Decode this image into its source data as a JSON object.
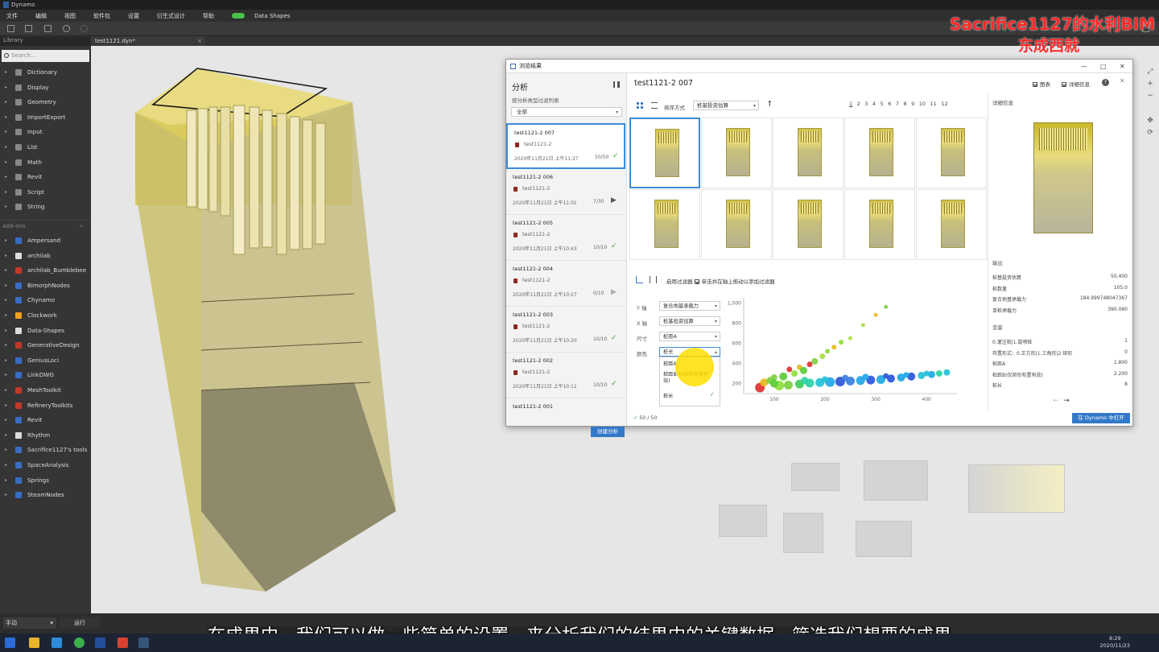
{
  "app": {
    "title": "Dynamo"
  },
  "menu": [
    "文件",
    "编辑",
    "视图",
    "软件包",
    "设置",
    "衍生式设计",
    "帮助",
    "Data Shapes"
  ],
  "library": {
    "title": "Library",
    "search_placeholder": "Search...",
    "core_items": [
      "Dictionary",
      "Display",
      "Geometry",
      "ImportExport",
      "Input",
      "List",
      "Math",
      "Revit",
      "Script",
      "String"
    ],
    "addons_title": "Add-ons",
    "addon_items": [
      "Ampersand",
      "archilab",
      "archilab_Bumblebee",
      "BimorphNodes",
      "Chynamo",
      "Clockwork",
      "Data-Shapes",
      "GenerativeDesign",
      "GeniusLoci",
      "LinkDWG",
      "MeshToolkit",
      "RefineryToolkits",
      "Revit",
      "Rhythm",
      "Sacrifice1127's tools",
      "SpaceAnalysis",
      "Springs",
      "SteamNodes"
    ]
  },
  "file_tab": {
    "label": "test1121.dyn*",
    "close": "×"
  },
  "watermark": {
    "line1": "Sacrifice1127的水利BIM",
    "line2": "东成西就"
  },
  "subtitle": "在成果中，我们可以做一些简单的设置，来分析我们的结果中的关键数据，筛选我们想要的成果",
  "bottom": {
    "run_mode": "手动",
    "run_button": "运行"
  },
  "taskbar": {
    "time": "8:29",
    "date": "2020/11/23"
  },
  "dialog": {
    "title": "浏览结果",
    "left": {
      "heading": "分析",
      "filter_label": "按分析类型过滤列表",
      "filter_value": "全部",
      "runs": [
        {
          "name": "test1121-2 007",
          "study": "test1121-2",
          "date": "2020年11月21日 上午11:27",
          "count": "50/50",
          "status": "✓"
        },
        {
          "name": "test1121-2 006",
          "study": "test1121-2",
          "date": "2020年11月21日 上午11:01",
          "count": "7/30",
          "status": "▶"
        },
        {
          "name": "test1121-2 005",
          "study": "test1121-2",
          "date": "2020年11月21日 上午10:43",
          "count": "10/10",
          "status": "✓"
        },
        {
          "name": "test1121-2 004",
          "study": "test1121-2",
          "date": "2020年11月21日 上午10:27",
          "count": "0/10",
          "status": "▶"
        },
        {
          "name": "test1121-2 003",
          "study": "test1121-2",
          "date": "2020年11月21日 上午10:20",
          "count": "10/10",
          "status": "✓"
        },
        {
          "name": "test1121-2 002",
          "study": "test1121-2",
          "date": "2020年11月21日 上午10:11",
          "count": "10/10",
          "status": "✓"
        },
        {
          "name": "test1121-2 001",
          "study": "",
          "date": "",
          "count": "",
          "status": ""
        }
      ],
      "create_button": "创建分析"
    },
    "main": {
      "heading": "test1121-2 007",
      "chart_toggle": "图表",
      "detail_toggle": "详细信息",
      "sort_label": "排序方式",
      "sort_value": "桩基投资估算",
      "pages": [
        "1",
        "2",
        "3",
        "4",
        "5",
        "6",
        "7",
        "8",
        "9",
        "10",
        "11",
        "12"
      ],
      "filter_enable": "启用过滤器",
      "filter_hint": "单击并在轴上拖动以添加过滤器",
      "y_label": "Y 轴",
      "y_value": "复合地基承载力",
      "x_label": "X 轴",
      "x_value": "桩基投资估算",
      "size_label": "尺寸",
      "size_value": "桩距A",
      "color_label": "颜色",
      "color_value": "桩长",
      "dropdown_options": [
        "桩距A",
        "桩距B(仅矩形布置有效)",
        "桩长"
      ],
      "result_count": "50 / 50",
      "open_button": "在 Dynamo 中打开"
    },
    "detail": {
      "title": "详细信息",
      "outputs_title": "输出",
      "outputs": [
        {
          "k": "桩基投资估算",
          "v": "50.400"
        },
        {
          "k": "桩数量",
          "v": "105.0"
        },
        {
          "k": "复合地基承载力",
          "v": "184.999748047367"
        },
        {
          "k": "单桩承载力",
          "v": "390.060"
        }
      ],
      "vars_title": "变量",
      "vars": [
        {
          "k": "0.灌注桩|1.旋喷桩",
          "v": "1"
        },
        {
          "k": "布置形式：0.正方形|1.三角形|2.矩形",
          "v": "0"
        },
        {
          "k": "桩距A",
          "v": "1.800"
        },
        {
          "k": "桩距B(仅矩形布置有效)",
          "v": "2.200"
        },
        {
          "k": "桩长",
          "v": "8"
        }
      ]
    }
  },
  "chart_data": {
    "type": "scatter",
    "x_ticks": [
      "100",
      "200",
      "300",
      "400"
    ],
    "y_ticks": [
      "1,000",
      "800",
      "600",
      "400",
      "200"
    ],
    "xlim": [
      40,
      460
    ],
    "ylim": [
      100,
      1050
    ],
    "points": [
      {
        "x": 72,
        "y": 160,
        "s": 10,
        "c": "#e03030"
      },
      {
        "x": 80,
        "y": 210,
        "s": 8,
        "c": "#e8b820"
      },
      {
        "x": 92,
        "y": 230,
        "s": 7,
        "c": "#7ed040"
      },
      {
        "x": 100,
        "y": 260,
        "s": 6,
        "c": "#7ed040"
      },
      {
        "x": 118,
        "y": 270,
        "s": 8,
        "c": "#5ccc3a"
      },
      {
        "x": 130,
        "y": 340,
        "s": 5,
        "c": "#e03030"
      },
      {
        "x": 140,
        "y": 300,
        "s": 6,
        "c": "#8edc3e"
      },
      {
        "x": 150,
        "y": 360,
        "s": 5,
        "c": "#e8b820"
      },
      {
        "x": 158,
        "y": 330,
        "s": 7,
        "c": "#5ccc3a"
      },
      {
        "x": 170,
        "y": 390,
        "s": 5,
        "c": "#e03030"
      },
      {
        "x": 180,
        "y": 420,
        "s": 6,
        "c": "#7ed040"
      },
      {
        "x": 195,
        "y": 470,
        "s": 5,
        "c": "#a8e040"
      },
      {
        "x": 205,
        "y": 520,
        "s": 4,
        "c": "#8edc3e"
      },
      {
        "x": 218,
        "y": 560,
        "s": 4,
        "c": "#e8b820"
      },
      {
        "x": 232,
        "y": 610,
        "s": 4,
        "c": "#8edc3e"
      },
      {
        "x": 250,
        "y": 650,
        "s": 3,
        "c": "#a8e040"
      },
      {
        "x": 275,
        "y": 780,
        "s": 3,
        "c": "#a8e040"
      },
      {
        "x": 300,
        "y": 880,
        "s": 3,
        "c": "#e8b820"
      },
      {
        "x": 320,
        "y": 960,
        "s": 3,
        "c": "#7ed040"
      },
      {
        "x": 110,
        "y": 180,
        "s": 10,
        "c": "#8edc3e"
      },
      {
        "x": 128,
        "y": 185,
        "s": 9,
        "c": "#7ed040"
      },
      {
        "x": 150,
        "y": 195,
        "s": 9,
        "c": "#3fcc5a"
      },
      {
        "x": 170,
        "y": 205,
        "s": 9,
        "c": "#2ad3a6"
      },
      {
        "x": 190,
        "y": 210,
        "s": 9,
        "c": "#22c0d8"
      },
      {
        "x": 210,
        "y": 215,
        "s": 10,
        "c": "#1ea7e6"
      },
      {
        "x": 230,
        "y": 220,
        "s": 10,
        "c": "#2b56d8"
      },
      {
        "x": 250,
        "y": 225,
        "s": 9,
        "c": "#3a80e0"
      },
      {
        "x": 270,
        "y": 230,
        "s": 9,
        "c": "#1ea7e6"
      },
      {
        "x": 290,
        "y": 235,
        "s": 9,
        "c": "#2b56d8"
      },
      {
        "x": 310,
        "y": 240,
        "s": 9,
        "c": "#1ea7e6"
      },
      {
        "x": 330,
        "y": 250,
        "s": 8,
        "c": "#2b56d8"
      },
      {
        "x": 350,
        "y": 260,
        "s": 8,
        "c": "#1ea7e6"
      },
      {
        "x": 370,
        "y": 270,
        "s": 8,
        "c": "#2b56d8"
      },
      {
        "x": 390,
        "y": 280,
        "s": 7,
        "c": "#22c0d8"
      },
      {
        "x": 410,
        "y": 290,
        "s": 7,
        "c": "#1ea7e6"
      },
      {
        "x": 425,
        "y": 300,
        "s": 6,
        "c": "#2ad3a6"
      },
      {
        "x": 440,
        "y": 310,
        "s": 6,
        "c": "#22c0d8"
      },
      {
        "x": 100,
        "y": 200,
        "s": 8,
        "c": "#5ccc3a"
      },
      {
        "x": 160,
        "y": 230,
        "s": 7,
        "c": "#2ad3a6"
      },
      {
        "x": 200,
        "y": 240,
        "s": 6,
        "c": "#22c0d8"
      },
      {
        "x": 240,
        "y": 255,
        "s": 6,
        "c": "#3a80e0"
      },
      {
        "x": 280,
        "y": 265,
        "s": 6,
        "c": "#1ea7e6"
      },
      {
        "x": 320,
        "y": 275,
        "s": 5,
        "c": "#2b56d8"
      },
      {
        "x": 360,
        "y": 285,
        "s": 5,
        "c": "#1ea7e6"
      },
      {
        "x": 400,
        "y": 300,
        "s": 5,
        "c": "#22c0d8"
      }
    ]
  }
}
